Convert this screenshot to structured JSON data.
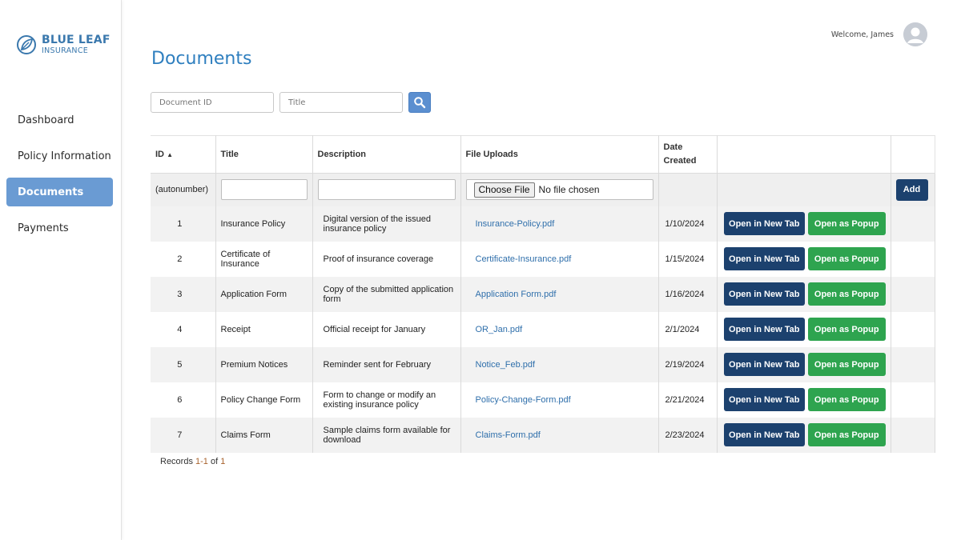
{
  "brand": {
    "title": "BLUE LEAF",
    "subtitle": "INSURANCE",
    "color": "#3a78ad"
  },
  "sidebar": {
    "items": [
      {
        "label": "Dashboard",
        "active": false
      },
      {
        "label": "Policy Information",
        "active": false
      },
      {
        "label": "Documents",
        "active": true
      },
      {
        "label": "Payments",
        "active": false
      }
    ],
    "active_color": "#6a9bd3"
  },
  "header": {
    "welcome": "Welcome, James",
    "avatar_icon": "user-avatar-icon"
  },
  "page": {
    "title": "Documents"
  },
  "search": {
    "document_id_placeholder": "Document ID",
    "title_placeholder": "Title",
    "button_icon": "search-icon"
  },
  "table": {
    "columns": {
      "id": "ID",
      "title": "Title",
      "description": "Description",
      "file_uploads": "File Uploads",
      "date_created_1": "Date",
      "date_created_2": "Created"
    },
    "sort": {
      "column": "ID",
      "direction": "ascending",
      "indicator": "▲"
    },
    "new_row": {
      "id_placeholder": "(autonumber)",
      "choose_file_label": "Choose File",
      "no_file_text": "No file chosen",
      "add_label": "Add"
    },
    "open_tab_label": "Open in New Tab",
    "open_popup_label": "Open as Popup",
    "rows": [
      {
        "id": "1",
        "title": "Insurance Policy",
        "description": "Digital version of the issued insurance policy",
        "file": "Insurance-Policy.pdf",
        "date": "1/10/2024"
      },
      {
        "id": "2",
        "title": "Certificate of Insurance",
        "description": "Proof of insurance coverage",
        "file": "Certificate-Insurance.pdf",
        "date": "1/15/2024"
      },
      {
        "id": "3",
        "title": "Application Form",
        "description": "Copy of the submitted application form",
        "file": "Application Form.pdf",
        "date": "1/16/2024"
      },
      {
        "id": "4",
        "title": "Receipt",
        "description": "Official receipt for January",
        "file": "OR_Jan.pdf",
        "date": "2/1/2024"
      },
      {
        "id": "5",
        "title": "Premium Notices",
        "description": "Reminder sent for February",
        "file": "Notice_Feb.pdf",
        "date": "2/19/2024"
      },
      {
        "id": "6",
        "title": "Policy Change Form",
        "description": "Form to change or modify an existing insurance policy",
        "file": "Policy-Change-Form.pdf",
        "date": "2/21/2024"
      },
      {
        "id": "7",
        "title": "Claims Form",
        "description": "Sample claims form available for download",
        "file": "Claims-Form.pdf",
        "date": "2/23/2024"
      }
    ]
  },
  "footer": {
    "records_prefix": "Records ",
    "records_range": "1-1",
    "records_of": " of ",
    "records_total": "1"
  },
  "colors": {
    "title_blue": "#2f7fbf",
    "navy_button": "#1c416e",
    "green_button": "#2ea44f",
    "link": "#2f6fab"
  }
}
